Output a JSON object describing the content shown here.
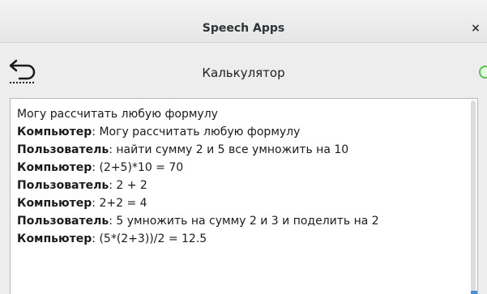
{
  "window": {
    "title": "Speech Apps",
    "close_label": "×"
  },
  "toolbar": {
    "app_title": "Калькулятор",
    "back_icon": "back-arrow-icon",
    "status_color": "#55c24a"
  },
  "chat": {
    "intro": "Могу рассчитать любую формулу",
    "messages": [
      {
        "speaker": "Компьютер",
        "text": ": Могу рассчитать любую формулу"
      },
      {
        "speaker": "Пользователь",
        "text": ": найти сумму 2 и 5 все умножить на 10"
      },
      {
        "speaker": "Компьютер",
        "text": ": (2+5)*10 = 70"
      },
      {
        "speaker": "Пользователь",
        "text": ": 2 + 2"
      },
      {
        "speaker": "Компьютер",
        "text": ": 2+2 = 4"
      },
      {
        "speaker": "Пользователь",
        "text": ": 5 умножить на сумму 2 и 3 и поделить на 2"
      },
      {
        "speaker": "Компьютер",
        "text": ": (5*(2+3))/2 = 12.5"
      }
    ]
  }
}
